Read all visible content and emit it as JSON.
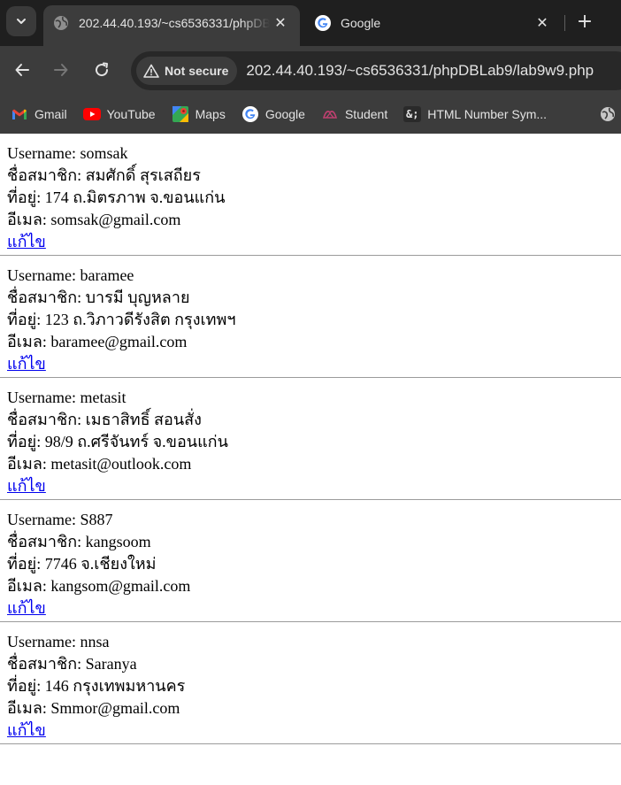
{
  "browser": {
    "tabs": [
      {
        "title": "202.44.40.193/~cs6536331/phpDBLab9/lab9w9.php",
        "active": true
      },
      {
        "title": "Google",
        "active": false
      }
    ],
    "tab_close_glyph": "✕",
    "new_tab_glyph": "+",
    "security_label": "Not secure",
    "url": "202.44.40.193/~cs6536331/phpDBLab9/lab9w9.php",
    "bookmarks": [
      {
        "label": "Gmail",
        "icon": "gmail-icon"
      },
      {
        "label": "YouTube",
        "icon": "youtube-icon"
      },
      {
        "label": "Maps",
        "icon": "maps-icon"
      },
      {
        "label": "Google",
        "icon": "google-icon"
      },
      {
        "label": "Student",
        "icon": "student-icon"
      },
      {
        "label": "HTML Number Sym...",
        "icon": "html-entity-icon",
        "icon_text": "&;"
      }
    ]
  },
  "labels": {
    "username": "Username: ",
    "name": "ชื่อสมาชิก: ",
    "address": "ที่อยู่: ",
    "email": "อีเมล: ",
    "edit": "แก้ไข"
  },
  "records": [
    {
      "username": "somsak",
      "name": "สมศักดิ์ สุรเสถียร",
      "address": "174 ถ.มิตรภาพ จ.ขอนแก่น",
      "email": "somsak@gmail.com"
    },
    {
      "username": "baramee",
      "name": "บารมี บุญหลาย",
      "address": "123 ถ.วิภาวดีรังสิต กรุงเทพฯ",
      "email": "baramee@gmail.com"
    },
    {
      "username": "metasit",
      "name": "เมธาสิทธิ์ สอนสั่ง",
      "address": "98/9 ถ.ศรีจันทร์ จ.ขอนแก่น",
      "email": "metasit@outlook.com"
    },
    {
      "username": "S887",
      "name": "kangsoom",
      "address": "7746 จ.เชียงใหม่",
      "email": "kangsom@gmail.com"
    },
    {
      "username": "nnsa",
      "name": "Saranya",
      "address": "146 กรุงเทพมหานคร",
      "email": "Smmor@gmail.com"
    }
  ],
  "colors": {
    "link": "#0000ee",
    "chrome_dark": "#1f1f1f",
    "chrome_toolbar": "#3c3c3c"
  }
}
